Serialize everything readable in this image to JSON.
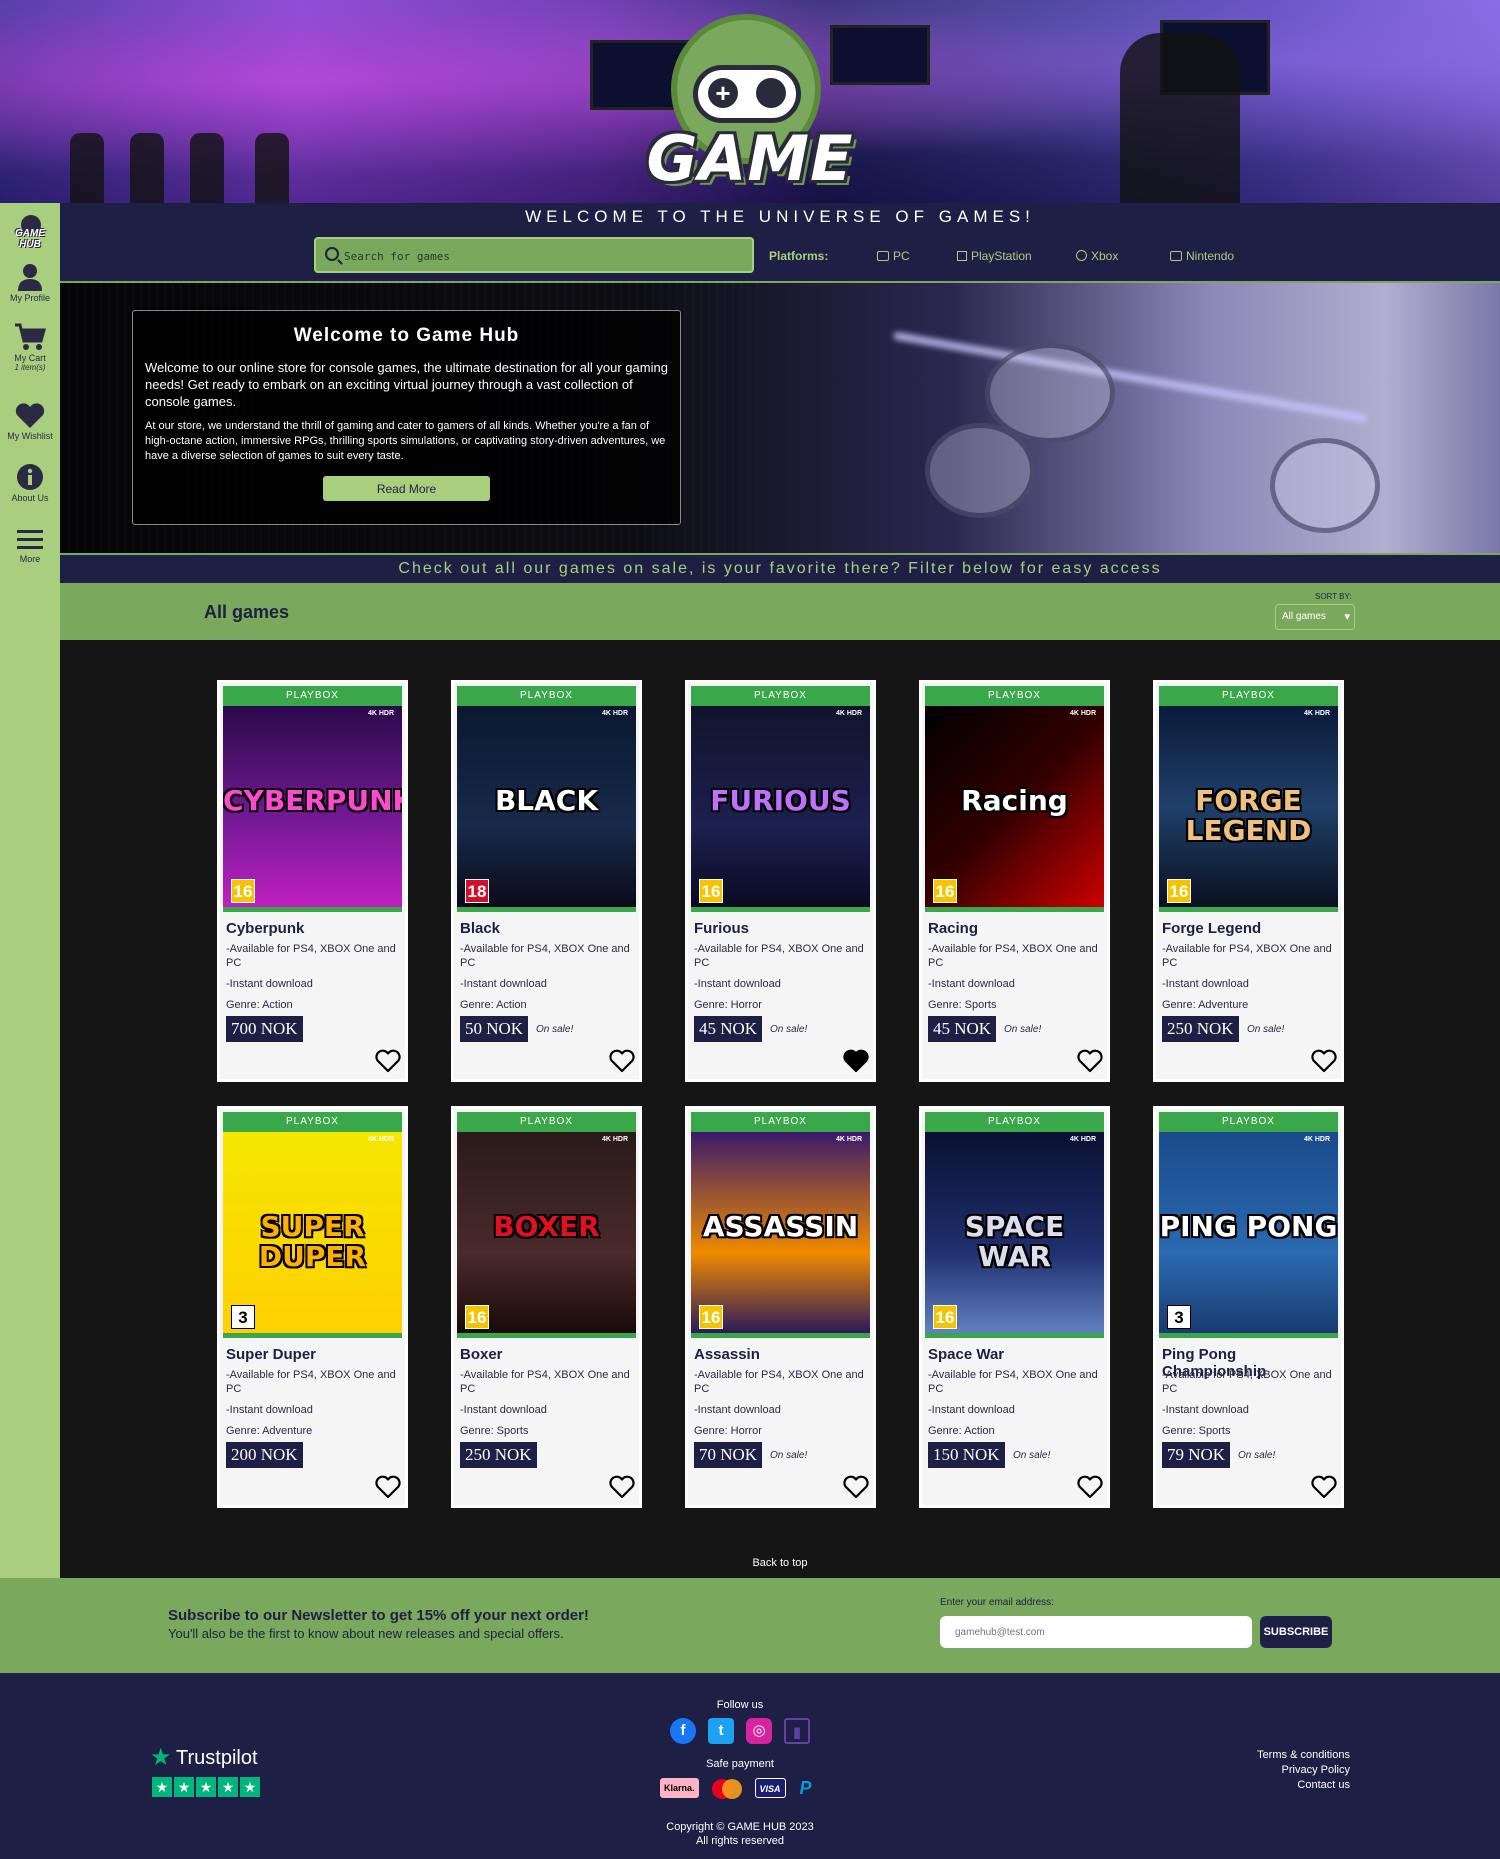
{
  "brand": {
    "logo_text": "GAME HUB",
    "sidebar_logo_text": "GAME HUB",
    "tagline": "WELCOME TO THE UNIVERSE OF GAMES!"
  },
  "sidebar": {
    "items": [
      {
        "label": "My Profile",
        "icon": "user-icon"
      },
      {
        "label": "My Cart",
        "sub": "1 item(s)",
        "icon": "cart-icon"
      },
      {
        "label": "My Wishlist",
        "icon": "heart-icon"
      },
      {
        "label": "About Us",
        "icon": "info-icon"
      },
      {
        "label": "More",
        "icon": "menu-icon"
      }
    ]
  },
  "search": {
    "placeholder": "Search for games"
  },
  "platforms": {
    "label": "Platforms:",
    "items": [
      "PC",
      "PlayStation",
      "Xbox",
      "Nintendo"
    ]
  },
  "welcome": {
    "title": "Welcome to Game Hub",
    "paragraph1": "Welcome to our online store for console games, the ultimate destination for all your gaming needs! Get ready to embark on an exciting virtual journey through a vast collection of console games.",
    "paragraph2": "At our store, we understand the thrill of gaming and cater to gamers of all kinds. Whether you're a fan of high-octane action, immersive RPGs, thrilling sports simulations, or captivating story-driven adventures, we have a diverse selection of games to suit every taste.",
    "read_more": "Read More"
  },
  "sale_banner": "Check out all our games on sale, is your favorite there? Filter below for easy access",
  "games_section": {
    "title": "All games",
    "sort_label": "SORT BY:",
    "sort_value": "All games",
    "back_to_top": "Back to top"
  },
  "card_common": {
    "brand": "PLAYBOX",
    "availability": "-Available for PS4, XBOX One and PC",
    "instant": "-Instant download",
    "hdr": "4K HDR"
  },
  "games": [
    {
      "name": "Cyberpunk",
      "art_title": "CYBERPUNK",
      "genre": "Genre: Action",
      "price": "700 NOK",
      "on_sale": "",
      "age": "16",
      "wishlisted": false
    },
    {
      "name": "Black",
      "art_title": "BLACK",
      "genre": "Genre: Action",
      "price": "50 NOK",
      "on_sale": "On sale!",
      "age": "18",
      "wishlisted": false
    },
    {
      "name": "Furious",
      "art_title": "FURIOUS",
      "genre": "Genre: Horror",
      "price": "45 NOK",
      "on_sale": "On sale!",
      "age": "16",
      "wishlisted": true
    },
    {
      "name": "Racing",
      "art_title": "Racing",
      "genre": "Genre: Sports",
      "price": "45 NOK",
      "on_sale": "On sale!",
      "age": "16",
      "wishlisted": false
    },
    {
      "name": "Forge Legend",
      "art_title": "FORGE LEGEND",
      "genre": "Genre: Adventure",
      "price": "250 NOK",
      "on_sale": "On sale!",
      "age": "16",
      "wishlisted": false
    },
    {
      "name": "Super Duper",
      "art_title": "SUPER DUPER",
      "genre": "Genre: Adventure",
      "price": "200 NOK",
      "on_sale": "",
      "age": "3",
      "wishlisted": false
    },
    {
      "name": "Boxer",
      "art_title": "BOXER",
      "genre": "Genre: Sports",
      "price": "250 NOK",
      "on_sale": "",
      "age": "16",
      "wishlisted": false
    },
    {
      "name": "Assassin",
      "art_title": "ASSASSIN",
      "genre": "Genre: Horror",
      "price": "70 NOK",
      "on_sale": "On sale!",
      "age": "16",
      "wishlisted": false
    },
    {
      "name": "Space War",
      "art_title": "SPACE WAR",
      "genre": "Genre: Action",
      "price": "150 NOK",
      "on_sale": "On sale!",
      "age": "16",
      "wishlisted": false
    },
    {
      "name": "Ping Pong Championship",
      "art_title": "PING PONG",
      "genre": "Genre: Sports",
      "price": "79 NOK",
      "on_sale": "On sale!",
      "age": "3",
      "wishlisted": false
    }
  ],
  "newsletter": {
    "title": "Subscribe to our Newsletter to get 15% off your next order!",
    "subtitle": "You'll also be the first to know about new releases and special offers.",
    "email_label": "Enter your email address:",
    "email_placeholder": "gamehub@test.com",
    "button": "SUBSCRIBE"
  },
  "footer": {
    "trustpilot": "Trustpilot",
    "follow_us": "Follow us",
    "safe_payment": "Safe payment",
    "payment_methods": [
      "Klarna.",
      "Mastercard",
      "VISA",
      "PayPal"
    ],
    "copyright": "Copyright © GAME HUB 2023",
    "rights": "All rights reserved",
    "links": [
      "Terms & conditions",
      "Privacy Policy",
      "Contact us"
    ]
  },
  "colors": {
    "navy": "#1e1f44",
    "green": "#7aa85c",
    "light_green": "#a9cf7e",
    "card_brand_green": "#3aa84a"
  }
}
